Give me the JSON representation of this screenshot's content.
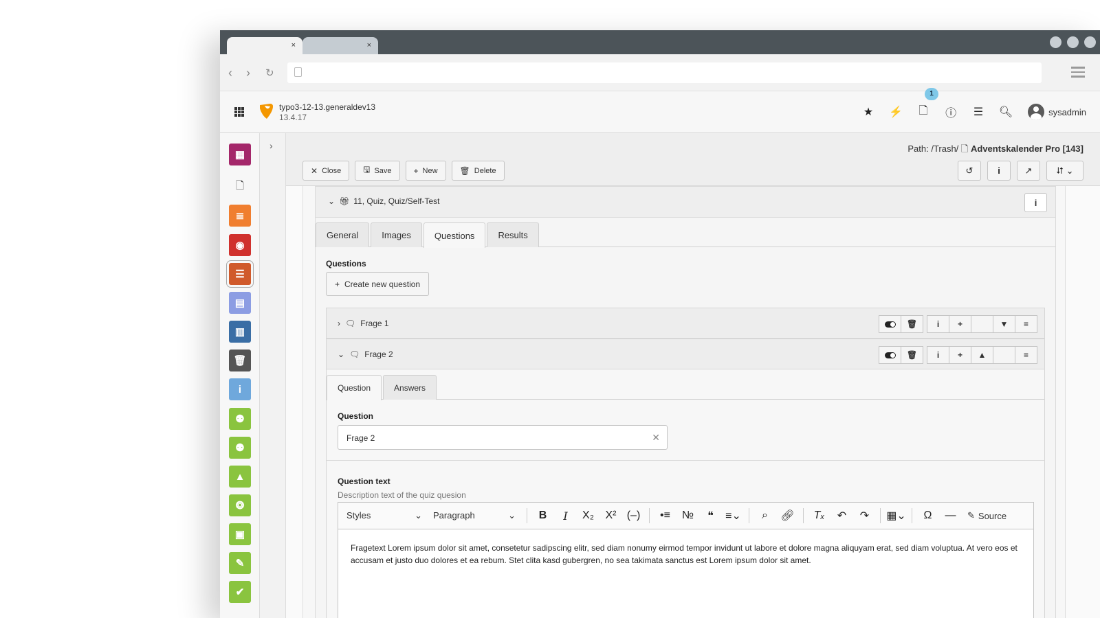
{
  "browser": {
    "tabs": [
      {
        "close": "×"
      },
      {
        "close": "×"
      }
    ]
  },
  "header": {
    "site_name": "typo3-12-13.generaldev13",
    "version": "13.4.17",
    "notification_count": "1",
    "username": "sysadmin"
  },
  "docheader": {
    "path_label": "Path: /Trash/",
    "record_title": "Adventskalender Pro [143]",
    "buttons": {
      "close": "Close",
      "save": "Save",
      "new": "New",
      "delete": "Delete"
    }
  },
  "record": {
    "title": "11, Quiz, Quiz/Self-Test",
    "tabs": [
      "General",
      "Images",
      "Questions",
      "Results"
    ],
    "active_tab": "Questions",
    "questions_label": "Questions",
    "create_button": "Create new question",
    "items": [
      {
        "label": "Frage 1"
      },
      {
        "label": "Frage 2"
      }
    ]
  },
  "question_form": {
    "tabs": [
      "Question",
      "Answers"
    ],
    "question_label": "Question",
    "question_value": "Frage 2",
    "text_label": "Question text",
    "text_description": "Description text of the quiz quesion",
    "editor": {
      "styles": "Styles",
      "paragraph": "Paragraph",
      "source": "Source",
      "content": "Fragetext Lorem ipsum dolor sit amet, consetetur sadipscing elitr, sed diam nonumy eirmod tempor invidunt ut labore et dolore magna aliquyam erat, sed diam voluptua. At vero eos et accusam et justo duo dolores et ea rebum. Stet clita kasd gubergren, no sea takimata sanctus est Lorem ipsum dolor sit amet."
    }
  },
  "colors": {
    "chrome": "#4c5459",
    "typo3_orange": "#f49700"
  }
}
